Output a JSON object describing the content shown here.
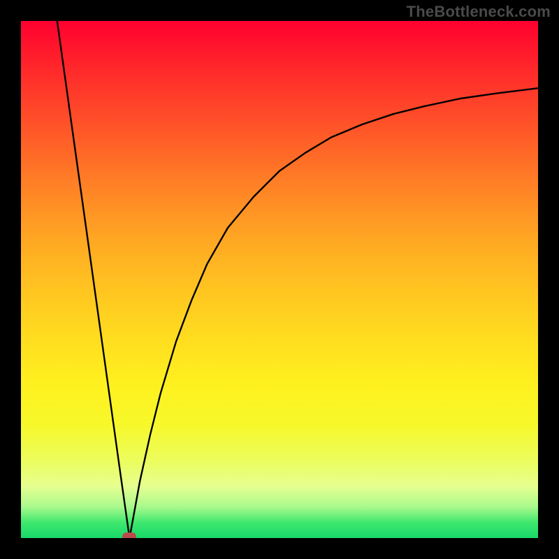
{
  "watermark": "TheBottleneck.com",
  "chart_data": {
    "type": "line",
    "title": "",
    "xlabel": "",
    "ylabel": "",
    "xlim": [
      0,
      100
    ],
    "ylim": [
      0,
      100
    ],
    "x_left_start": 7,
    "x_min": 21,
    "right_asymptote_y": 87,
    "series": [
      {
        "name": "curve",
        "x": [
          7,
          10,
          13,
          16,
          19,
          21,
          23,
          25,
          27,
          30,
          33,
          36,
          40,
          45,
          50,
          55,
          60,
          66,
          72,
          78,
          85,
          92,
          100
        ],
        "y": [
          100,
          78.5,
          57.1,
          35.6,
          14.1,
          0,
          11,
          20,
          28,
          38,
          46,
          53,
          60,
          66,
          71,
          74.5,
          77.5,
          80,
          82,
          83.5,
          85,
          86,
          87
        ]
      }
    ],
    "marker": {
      "x": 21,
      "y": 0,
      "color": "#ba4c4c"
    },
    "background": "vertical-gradient red→orange→yellow→green",
    "grid": false,
    "legend": false
  }
}
